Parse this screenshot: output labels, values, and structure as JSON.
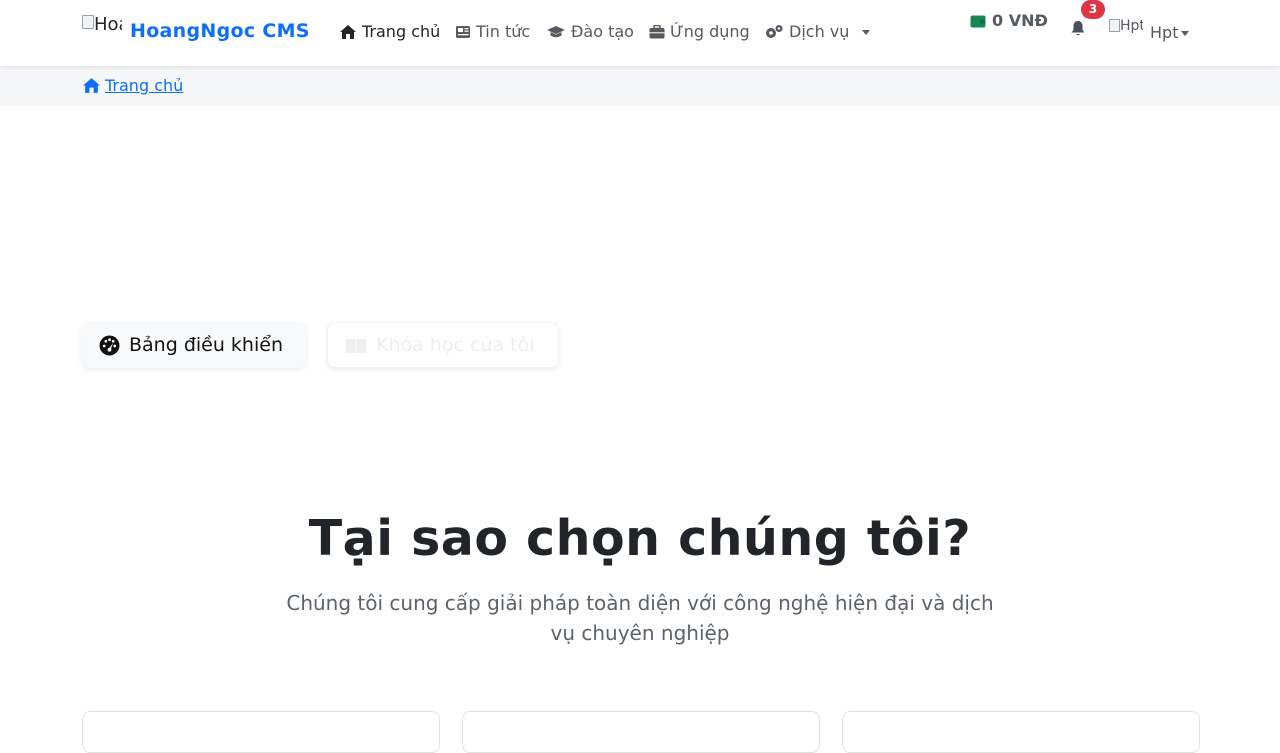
{
  "brand": {
    "logo_alt": "HoangNgoc",
    "name": "HoangNgoc CMS"
  },
  "nav": {
    "items": [
      {
        "label": "Trang chủ",
        "icon": "home-icon",
        "active": true
      },
      {
        "label": "Tin tức",
        "icon": "newspaper-icon"
      },
      {
        "label": "Đào tạo",
        "icon": "graduation-cap-icon"
      },
      {
        "label": "Ứng dụng",
        "icon": "briefcase-icon"
      },
      {
        "label": "Dịch vụ",
        "icon": "cogs-icon",
        "dropdown": true
      }
    ]
  },
  "wallet": {
    "balance": "0 VNĐ",
    "icon": "wallet-icon"
  },
  "notifications": {
    "count": "3",
    "icon": "bell-icon"
  },
  "user": {
    "avatar_alt": "Hpt",
    "name": "Hpt"
  },
  "breadcrumb": {
    "home_label": "Trang chủ"
  },
  "quick_actions": {
    "dashboard_label": "Bảng điều khiển",
    "my_courses_label": "Khóa học của tôi"
  },
  "why": {
    "title": "Tại sao chọn chúng tôi?",
    "subtitle": "Chúng tôi cung cấp giải pháp toàn diện với công nghệ hiện đại và dịch vụ chuyên nghiệp"
  },
  "colors": {
    "brand": "#0d6efd",
    "wallet": "#198754",
    "badge": "#dc3545"
  }
}
